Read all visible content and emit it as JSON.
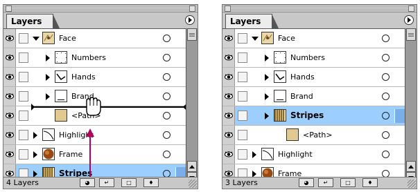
{
  "panels": [
    {
      "tab_label": "Layers",
      "layer_count": "4 Layers",
      "rows": [
        {
          "label": "Face",
          "thumb": "face",
          "twisty": "down",
          "indent": 0,
          "bold": false,
          "selected": false
        },
        {
          "label": "Numbers",
          "thumb": "dots",
          "twisty": "right",
          "indent": 1,
          "bold": false,
          "selected": false
        },
        {
          "label": "Hands",
          "thumb": "hands",
          "twisty": "right",
          "indent": 1,
          "bold": false,
          "selected": false
        },
        {
          "label": "Brand",
          "thumb": "brand",
          "twisty": "right",
          "indent": 1,
          "bold": false,
          "selected": false
        },
        {
          "label": "<Path>",
          "thumb": "tan",
          "twisty": "none",
          "indent": 1,
          "bold": false,
          "selected": false,
          "drop_target": true
        },
        {
          "label": "Highlight",
          "thumb": "highlight",
          "twisty": "right",
          "indent": 0,
          "bold": false,
          "selected": false
        },
        {
          "label": "Frame",
          "thumb": "frame",
          "twisty": "right",
          "indent": 0,
          "bold": false,
          "selected": false
        },
        {
          "label": "Stripes",
          "thumb": "stripes",
          "twisty": "right",
          "indent": 0,
          "bold": true,
          "selected": true
        }
      ],
      "drag_cursor": "grab-hand-icon",
      "drag_arrow_color": "#b0005a"
    },
    {
      "tab_label": "Layers",
      "layer_count": "3 Layers",
      "rows": [
        {
          "label": "Face",
          "thumb": "face",
          "twisty": "down",
          "indent": 0,
          "bold": false,
          "selected": false
        },
        {
          "label": "Numbers",
          "thumb": "dots",
          "twisty": "right",
          "indent": 1,
          "bold": false,
          "selected": false
        },
        {
          "label": "Hands",
          "thumb": "hands",
          "twisty": "right",
          "indent": 1,
          "bold": false,
          "selected": false
        },
        {
          "label": "Brand",
          "thumb": "brand",
          "twisty": "right",
          "indent": 1,
          "bold": false,
          "selected": false
        },
        {
          "label": "Stripes",
          "thumb": "stripes",
          "twisty": "right",
          "indent": 1,
          "bold": true,
          "selected": true
        },
        {
          "label": "<Path>",
          "thumb": "tan",
          "twisty": "none",
          "indent": 2,
          "bold": false,
          "selected": false
        },
        {
          "label": "Highlight",
          "thumb": "highlight",
          "twisty": "right",
          "indent": 0,
          "bold": false,
          "selected": false
        },
        {
          "label": "Frame",
          "thumb": "frame",
          "twisty": "right",
          "indent": 0,
          "bold": false,
          "selected": false
        }
      ]
    }
  ],
  "footer_buttons": [
    "make-clipping-mask-icon",
    "new-sublayer-icon",
    "new-layer-icon",
    "trash-icon"
  ],
  "colors": {
    "selected_row": "#9ccfff",
    "panel_bg": "#c8c8c8"
  }
}
